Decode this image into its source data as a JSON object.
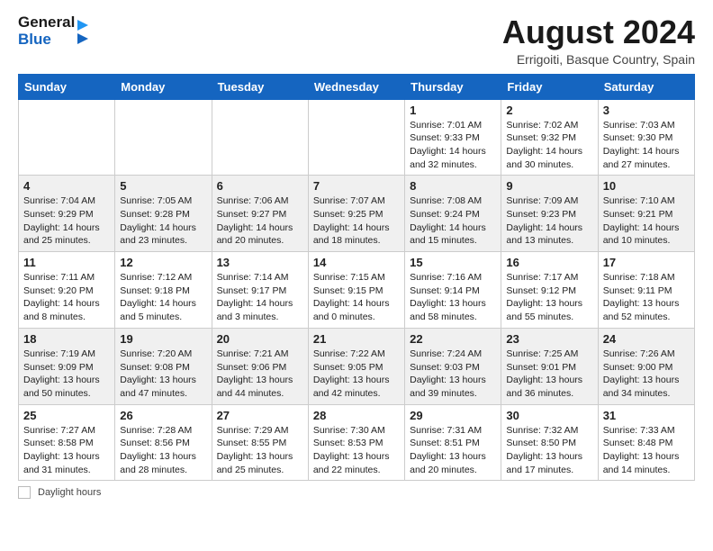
{
  "header": {
    "logo_line1": "General",
    "logo_line2": "Blue",
    "title": "August 2024",
    "subtitle": "Errigoiti, Basque Country, Spain"
  },
  "days_of_week": [
    "Sunday",
    "Monday",
    "Tuesday",
    "Wednesday",
    "Thursday",
    "Friday",
    "Saturday"
  ],
  "weeks": [
    [
      {
        "num": "",
        "info": ""
      },
      {
        "num": "",
        "info": ""
      },
      {
        "num": "",
        "info": ""
      },
      {
        "num": "",
        "info": ""
      },
      {
        "num": "1",
        "info": "Sunrise: 7:01 AM\nSunset: 9:33 PM\nDaylight: 14 hours and 32 minutes."
      },
      {
        "num": "2",
        "info": "Sunrise: 7:02 AM\nSunset: 9:32 PM\nDaylight: 14 hours and 30 minutes."
      },
      {
        "num": "3",
        "info": "Sunrise: 7:03 AM\nSunset: 9:30 PM\nDaylight: 14 hours and 27 minutes."
      }
    ],
    [
      {
        "num": "4",
        "info": "Sunrise: 7:04 AM\nSunset: 9:29 PM\nDaylight: 14 hours and 25 minutes."
      },
      {
        "num": "5",
        "info": "Sunrise: 7:05 AM\nSunset: 9:28 PM\nDaylight: 14 hours and 23 minutes."
      },
      {
        "num": "6",
        "info": "Sunrise: 7:06 AM\nSunset: 9:27 PM\nDaylight: 14 hours and 20 minutes."
      },
      {
        "num": "7",
        "info": "Sunrise: 7:07 AM\nSunset: 9:25 PM\nDaylight: 14 hours and 18 minutes."
      },
      {
        "num": "8",
        "info": "Sunrise: 7:08 AM\nSunset: 9:24 PM\nDaylight: 14 hours and 15 minutes."
      },
      {
        "num": "9",
        "info": "Sunrise: 7:09 AM\nSunset: 9:23 PM\nDaylight: 14 hours and 13 minutes."
      },
      {
        "num": "10",
        "info": "Sunrise: 7:10 AM\nSunset: 9:21 PM\nDaylight: 14 hours and 10 minutes."
      }
    ],
    [
      {
        "num": "11",
        "info": "Sunrise: 7:11 AM\nSunset: 9:20 PM\nDaylight: 14 hours and 8 minutes."
      },
      {
        "num": "12",
        "info": "Sunrise: 7:12 AM\nSunset: 9:18 PM\nDaylight: 14 hours and 5 minutes."
      },
      {
        "num": "13",
        "info": "Sunrise: 7:14 AM\nSunset: 9:17 PM\nDaylight: 14 hours and 3 minutes."
      },
      {
        "num": "14",
        "info": "Sunrise: 7:15 AM\nSunset: 9:15 PM\nDaylight: 14 hours and 0 minutes."
      },
      {
        "num": "15",
        "info": "Sunrise: 7:16 AM\nSunset: 9:14 PM\nDaylight: 13 hours and 58 minutes."
      },
      {
        "num": "16",
        "info": "Sunrise: 7:17 AM\nSunset: 9:12 PM\nDaylight: 13 hours and 55 minutes."
      },
      {
        "num": "17",
        "info": "Sunrise: 7:18 AM\nSunset: 9:11 PM\nDaylight: 13 hours and 52 minutes."
      }
    ],
    [
      {
        "num": "18",
        "info": "Sunrise: 7:19 AM\nSunset: 9:09 PM\nDaylight: 13 hours and 50 minutes."
      },
      {
        "num": "19",
        "info": "Sunrise: 7:20 AM\nSunset: 9:08 PM\nDaylight: 13 hours and 47 minutes."
      },
      {
        "num": "20",
        "info": "Sunrise: 7:21 AM\nSunset: 9:06 PM\nDaylight: 13 hours and 44 minutes."
      },
      {
        "num": "21",
        "info": "Sunrise: 7:22 AM\nSunset: 9:05 PM\nDaylight: 13 hours and 42 minutes."
      },
      {
        "num": "22",
        "info": "Sunrise: 7:24 AM\nSunset: 9:03 PM\nDaylight: 13 hours and 39 minutes."
      },
      {
        "num": "23",
        "info": "Sunrise: 7:25 AM\nSunset: 9:01 PM\nDaylight: 13 hours and 36 minutes."
      },
      {
        "num": "24",
        "info": "Sunrise: 7:26 AM\nSunset: 9:00 PM\nDaylight: 13 hours and 34 minutes."
      }
    ],
    [
      {
        "num": "25",
        "info": "Sunrise: 7:27 AM\nSunset: 8:58 PM\nDaylight: 13 hours and 31 minutes."
      },
      {
        "num": "26",
        "info": "Sunrise: 7:28 AM\nSunset: 8:56 PM\nDaylight: 13 hours and 28 minutes."
      },
      {
        "num": "27",
        "info": "Sunrise: 7:29 AM\nSunset: 8:55 PM\nDaylight: 13 hours and 25 minutes."
      },
      {
        "num": "28",
        "info": "Sunrise: 7:30 AM\nSunset: 8:53 PM\nDaylight: 13 hours and 22 minutes."
      },
      {
        "num": "29",
        "info": "Sunrise: 7:31 AM\nSunset: 8:51 PM\nDaylight: 13 hours and 20 minutes."
      },
      {
        "num": "30",
        "info": "Sunrise: 7:32 AM\nSunset: 8:50 PM\nDaylight: 13 hours and 17 minutes."
      },
      {
        "num": "31",
        "info": "Sunrise: 7:33 AM\nSunset: 8:48 PM\nDaylight: 13 hours and 14 minutes."
      }
    ]
  ],
  "footer": {
    "legend_label": "Daylight hours"
  }
}
